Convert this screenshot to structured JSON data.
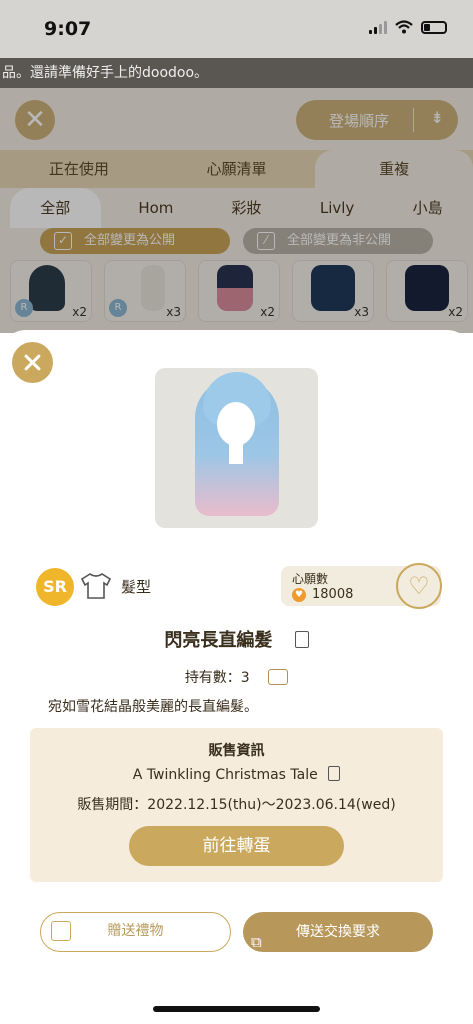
{
  "status_bar": {
    "time": "9:07"
  },
  "marquee": {
    "text": "品。還請準備好手上的doodoo。"
  },
  "background": {
    "sort_label": "登場順序",
    "tabs": [
      {
        "label": "正在使用"
      },
      {
        "label": "心願清單"
      },
      {
        "label": "重複"
      }
    ],
    "subtabs": [
      {
        "label": "全部"
      },
      {
        "label": "Hom"
      },
      {
        "label": "彩妝"
      },
      {
        "label": "Livly"
      },
      {
        "label": "小島"
      }
    ],
    "make_public": "全部變更為公開",
    "make_private": "全部變更為非公開",
    "thumbnails": [
      {
        "qty": "x2",
        "badge": "R"
      },
      {
        "qty": "x3",
        "badge": "R"
      },
      {
        "qty": "x2",
        "badge": ""
      },
      {
        "qty": "x3",
        "badge": ""
      },
      {
        "qty": "x2",
        "badge": ""
      }
    ]
  },
  "item": {
    "rarity": "SR",
    "category": "髮型",
    "wish_label": "心願數",
    "wish_count": "18008",
    "name": "閃亮長直編髮",
    "owned": "持有數：3",
    "description": "宛如雪花結晶般美麗的長直編髮。"
  },
  "sales": {
    "title": "販售資訊",
    "event": "A Twinkling Christmas Tale",
    "period": "販售期間：2022.12.15(thu)～2023.06.14(wed)",
    "gacha_button": "前往轉蛋"
  },
  "actions": {
    "gift": "贈送禮物",
    "trade": "傳送交換要求"
  },
  "colors": {
    "gold": "#caa95e",
    "beige": "#f5ecdc",
    "rarity": "#efb52b"
  }
}
